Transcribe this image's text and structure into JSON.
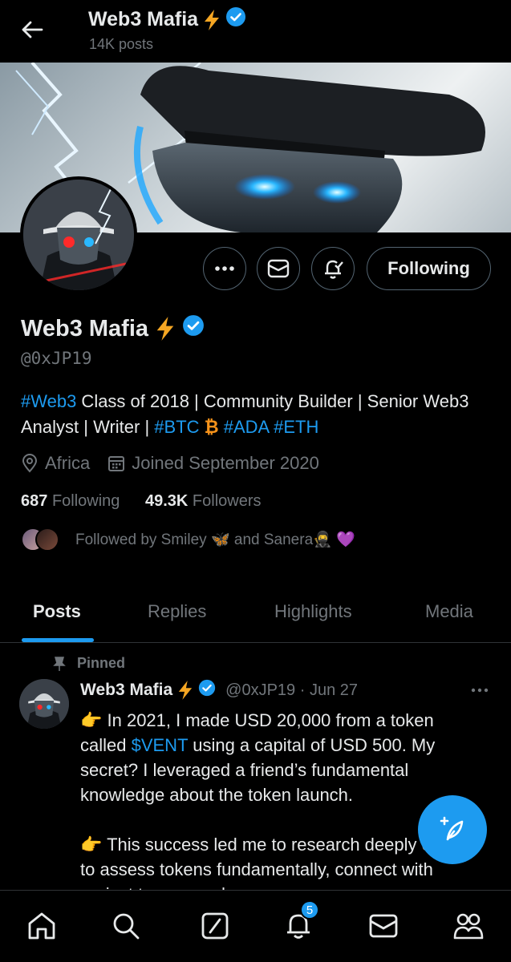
{
  "header": {
    "title": "Web3 Mafia",
    "posts_count": "14K posts"
  },
  "profile": {
    "name": "Web3 Mafia",
    "handle": "@0xJP19",
    "bio": {
      "tag1": "#Web3",
      "text1": " Class of 2018 | Community Builder | Senior Web3 Analyst | Writer | ",
      "tag2": "#BTC",
      "tag3": "#ADA",
      "tag4": "#ETH"
    },
    "location": "Africa",
    "joined": "Joined September 2020",
    "following_count": "687",
    "following_label": "Following",
    "followers_count": "49.3K",
    "followers_label": "Followers",
    "followed_by": "Followed by Smiley 🦋 and Sanera🥷 💜"
  },
  "actions": {
    "following_button": "Following"
  },
  "tabs": [
    {
      "label": "Posts",
      "active": true
    },
    {
      "label": "Replies",
      "active": false
    },
    {
      "label": "Highlights",
      "active": false
    },
    {
      "label": "Media",
      "active": false
    }
  ],
  "post": {
    "pinned_label": "Pinned",
    "author": "Web3 Mafia",
    "handle_date": "@0xJP19 · Jun 27",
    "para1_a": "👉 In 2021, I made USD 20,000 from a token called ",
    "para1_link": "$VENT",
    "para1_b": " using a capital of USD 500. My secret? I leveraged a friend’s fundamental knowledge about the token launch.",
    "para2": "👉 This success led me to research deeply on how to assess tokens fundamentally, connect with project teams, and"
  },
  "nav": {
    "notification_badge": "5"
  },
  "colors": {
    "accent": "#1d9bf0",
    "background": "#000000",
    "muted": "#71767b",
    "bolt": "#f5a623"
  }
}
